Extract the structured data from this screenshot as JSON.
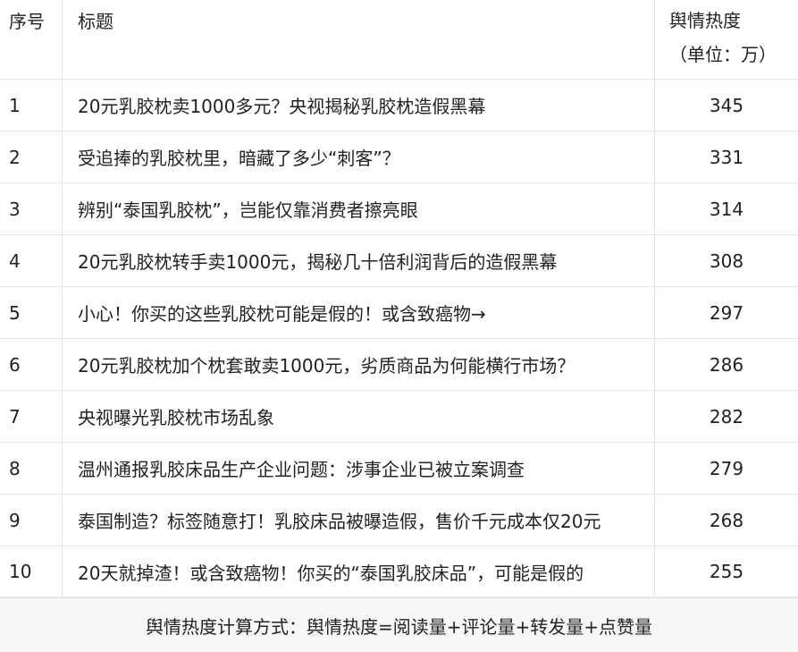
{
  "header": {
    "col_index": "序号",
    "col_title": "标题",
    "col_heat_line1": "舆情热度",
    "col_heat_line2": "（单位：万）"
  },
  "rows": [
    {
      "index": "1",
      "title": "20元乳胶枕卖1000多元？央视揭秘乳胶枕造假黑幕",
      "heat": "345"
    },
    {
      "index": "2",
      "title": "受追捧的乳胶枕里，暗藏了多少“刺客”？",
      "heat": "331"
    },
    {
      "index": "3",
      "title": "辨别“泰国乳胶枕”，岂能仅靠消费者擦亮眼",
      "heat": "314"
    },
    {
      "index": "4",
      "title": "20元乳胶枕转手卖1000元，揭秘几十倍利润背后的造假黑幕",
      "heat": "308"
    },
    {
      "index": "5",
      "title": "小心！你买的这些乳胶枕可能是假的！或含致癌物→",
      "heat": "297"
    },
    {
      "index": "6",
      "title": "20元乳胶枕加个枕套敢卖1000元，劣质商品为何能横行市场？",
      "heat": "286"
    },
    {
      "index": "7",
      "title": "央视曝光乳胶枕市场乱象",
      "heat": "282"
    },
    {
      "index": "8",
      "title": "温州通报乳胶床品生产企业问题：涉事企业已被立案调查",
      "heat": "279"
    },
    {
      "index": "9",
      "title": "泰国制造？标签随意打！乳胶床品被曝造假，售价千元成本仅20元",
      "heat": "268"
    },
    {
      "index": "10",
      "title": "20天就掉渣！或含致癌物！你买的“泰国乳胶床品”，可能是假的",
      "heat": "255"
    }
  ],
  "footer": {
    "note": "舆情热度计算方式：舆情热度=阅读量+评论量+转发量+点赞量"
  }
}
